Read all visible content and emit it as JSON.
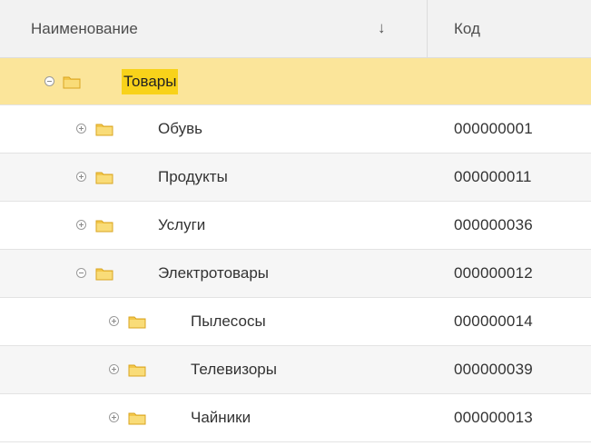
{
  "header": {
    "name_label": "Наименование",
    "sort_arrow": "↓",
    "code_label": "Код"
  },
  "rows": [
    {
      "name": "Товары",
      "code": "",
      "level": 0,
      "expanded": true
    },
    {
      "name": "Обувь",
      "code": "000000001",
      "level": 1,
      "expanded": false
    },
    {
      "name": "Продукты",
      "code": "000000011",
      "level": 1,
      "expanded": false
    },
    {
      "name": "Услуги",
      "code": "000000036",
      "level": 1,
      "expanded": false
    },
    {
      "name": "Электротовары",
      "code": "000000012",
      "level": 1,
      "expanded": true
    },
    {
      "name": "Пылесосы",
      "code": "000000014",
      "level": 2,
      "expanded": false
    },
    {
      "name": "Телевизоры",
      "code": "000000039",
      "level": 2,
      "expanded": false
    },
    {
      "name": "Чайники",
      "code": "000000013",
      "level": 2,
      "expanded": false
    }
  ],
  "colors": {
    "selected_row": "#fbe59a",
    "selected_label": "#f8d21a",
    "folder": "#f3c74a"
  }
}
